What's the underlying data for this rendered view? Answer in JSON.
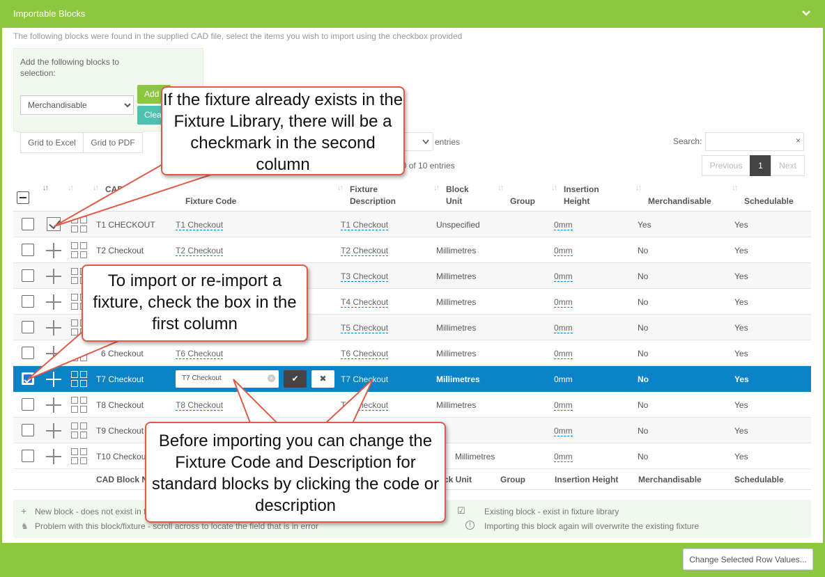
{
  "header": {
    "title": "Importable Blocks"
  },
  "intro": "The following blocks were found in the supplied CAD file, select the items you wish to import using the checkbox provided",
  "add_panel": {
    "label": "Add the following blocks to selection:",
    "select_value": "Merchandisable",
    "add_label": "Add",
    "clear_label": "Clear"
  },
  "toolbar": {
    "excel": "Grid to Excel",
    "pdf": "Grid to PDF",
    "entries_label": "entries",
    "info": "o 10 of 10 entries",
    "search_label": "Search:",
    "search_clear": "×",
    "prev": "Previous",
    "page": "1",
    "next": "Next"
  },
  "columns": {
    "cad": "CAD B",
    "cad2": "N",
    "fixture_code": "Fixture Code",
    "fixture_desc_1": "Fixture",
    "fixture_desc_2": "Description",
    "block_unit_1": "Block",
    "block_unit_2": "Unit",
    "group": "Group",
    "ins_1": "Insertion",
    "ins_2": "Height",
    "merch": "Merchandisable",
    "sched": "Schedulable"
  },
  "rows": [
    {
      "cad": "T1 CHECKOUT",
      "code": "T1 Checkout",
      "desc": "T1 Checkout",
      "unit": "Unspecified",
      "height": "0mm",
      "merch": "Yes",
      "sched": "Yes"
    },
    {
      "cad": "T2 Checkout",
      "code": "T2 Checkout",
      "desc": "T2 Checkout",
      "unit": "Millimetres",
      "height": "0mm",
      "merch": "No",
      "sched": "Yes"
    },
    {
      "cad": "",
      "code": "",
      "desc": "T3 Checkout",
      "unit": "Millimetres",
      "height": "0mm",
      "merch": "No",
      "sched": "Yes"
    },
    {
      "cad": "",
      "code": "",
      "desc": "T4 Checkout",
      "unit": "Millimetres",
      "height": "0mm",
      "merch": "No",
      "sched": "Yes"
    },
    {
      "cad": "",
      "code": "",
      "desc": "T5 Checkout",
      "unit": "Millimetres",
      "height": "0mm",
      "merch": "No",
      "sched": "Yes"
    },
    {
      "cad": "6 Checkout",
      "code": "T6 Checkout",
      "desc": "T6 Checkout",
      "unit": "Millimetres",
      "height": "0mm",
      "merch": "No",
      "sched": "Yes"
    },
    {
      "cad": "T7 Checkout",
      "code": "T7 Checkout",
      "desc": "T7 Checkout",
      "unit": "Millimetres",
      "height": "0mm",
      "merch": "No",
      "sched": "Yes"
    },
    {
      "cad": "T8 Checkout",
      "code": "T8 Checkout",
      "desc": "T8 Checkout",
      "unit": "Millimetres",
      "height": "0mm",
      "merch": "No",
      "sched": "Yes"
    },
    {
      "cad": "T9 Checkout",
      "code": "",
      "desc": "",
      "unit": "",
      "height": "0mm",
      "merch": "No",
      "sched": "Yes"
    },
    {
      "cad": "T10 Checkout",
      "code": "",
      "desc": "",
      "unit": "Millimetres",
      "height": "0mm",
      "merch": "No",
      "sched": "Yes"
    }
  ],
  "footer_cols": {
    "cad": "CAD Block N",
    "unit": "ck Unit",
    "group": "Group",
    "ins": "Insertion Height",
    "merch": "Merchandisable",
    "sched": "Schedulable"
  },
  "legend": {
    "new": "New block - does not exist in f",
    "problem": "Problem with this block/fixture - scroll across to locate the field that is in error",
    "existing": "Existing block - exist in fixture library",
    "overwrite": "Importing this block again will overwrite the existing fixture"
  },
  "change_button": "Change Selected Row Values...",
  "callouts": {
    "top": "If the fixture already exists in the Fixture Library, there will be a checkmark in the second column",
    "mid": "To import or re-import a fixture, check the box in the first column",
    "bottom": "Before importing you can change the Fixture Code and Description for standard blocks by clicking the code or description"
  }
}
